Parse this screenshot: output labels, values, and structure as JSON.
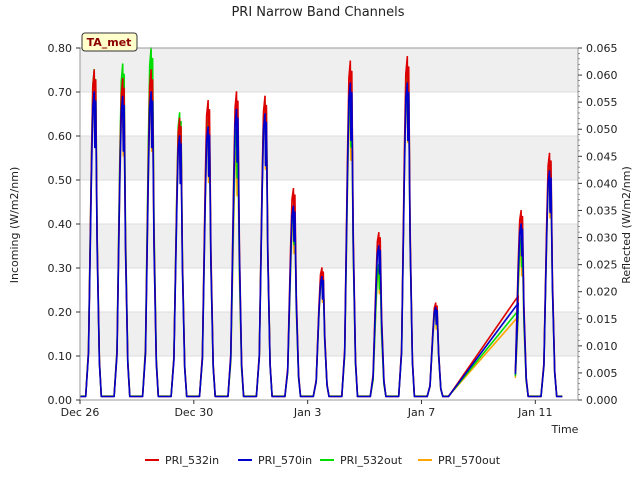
{
  "chart_data": {
    "type": "line",
    "title": "PRI Narrow Band Channels",
    "xlabel": "Time",
    "ylabel_left": "Incoming (W/m2/nm)",
    "ylabel_right": "Reflected (W/m2/nm)",
    "site_badge": "TA_met",
    "x_ticks": [
      "Dec 26",
      "Dec 30",
      "Jan 3",
      "Jan 7",
      "Jan 11"
    ],
    "x_tick_days": [
      0,
      4,
      8,
      12,
      16
    ],
    "xlim_days": [
      0,
      17.5
    ],
    "ylim_left": [
      0,
      0.8
    ],
    "yticks_left": [
      "0.00",
      "0.10",
      "0.20",
      "0.30",
      "0.40",
      "0.50",
      "0.60",
      "0.70",
      "0.80"
    ],
    "ylim_right": [
      0,
      0.065
    ],
    "yticks_right": [
      "0.000",
      "0.005",
      "0.010",
      "0.015",
      "0.020",
      "0.025",
      "0.030",
      "0.035",
      "0.040",
      "0.045",
      "0.050",
      "0.055",
      "0.060",
      "0.065"
    ],
    "grid": true,
    "legend_position": "bottom",
    "series": [
      {
        "name": "PRI_532in",
        "color": "#dd0000",
        "axis": "left",
        "peaks": [
          0.75,
          0.73,
          0.75,
          0.64,
          0.68,
          0.7,
          0.69,
          0.48,
          0.3,
          0.77,
          0.38,
          0.78,
          0.22,
          0.43,
          0.56
        ]
      },
      {
        "name": "PRI_570in",
        "color": "#0000cc",
        "axis": "left",
        "peaks": [
          0.7,
          0.69,
          0.7,
          0.6,
          0.62,
          0.66,
          0.65,
          0.44,
          0.28,
          0.72,
          0.35,
          0.72,
          0.21,
          0.4,
          0.52
        ]
      },
      {
        "name": "PRI_532out",
        "color": "#00dd00",
        "axis": "right",
        "peaks": [
          0.061,
          0.062,
          0.065,
          0.053,
          0.052,
          0.05,
          0.055,
          0.035,
          0.023,
          0.057,
          0.025,
          0.06,
          0.017,
          0.03,
          0.043
        ]
      },
      {
        "name": "PRI_570out",
        "color": "#ffa500",
        "axis": "right",
        "peaks": [
          0.057,
          0.055,
          0.056,
          0.05,
          0.049,
          0.046,
          0.052,
          0.033,
          0.022,
          0.054,
          0.024,
          0.058,
          0.016,
          0.028,
          0.041
        ]
      }
    ],
    "peak_days": [
      0.5,
      1.5,
      2.5,
      3.5,
      4.5,
      5.5,
      6.5,
      7.5,
      8.5,
      9.5,
      10.5,
      11.5,
      12.5,
      15.5,
      16.5
    ]
  }
}
